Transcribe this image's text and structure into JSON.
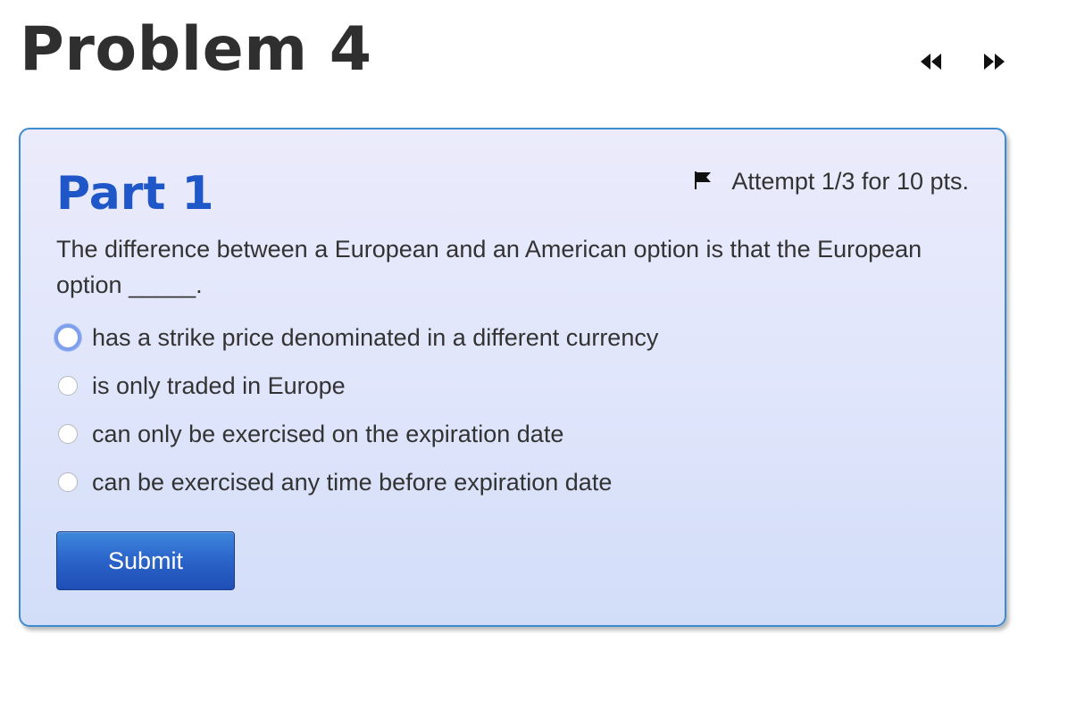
{
  "problem": {
    "title": "Problem 4"
  },
  "nav": {
    "prev_icon": "rewind-icon",
    "next_icon": "fast-forward-icon"
  },
  "part": {
    "title": "Part 1",
    "flag_icon": "flag-icon",
    "attempt_text": "Attempt 1/3 for 10 pts.",
    "question": "The difference between a European and an American option is that the European option _____.",
    "choices": [
      {
        "label": "has a strike price denominated in a different currency",
        "focused": true
      },
      {
        "label": "is only traded in Europe",
        "focused": false
      },
      {
        "label": "can only be exercised on the expiration date",
        "focused": false
      },
      {
        "label": "can be exercised any time before expiration date",
        "focused": false
      }
    ],
    "submit_label": "Submit"
  },
  "colors": {
    "title_text": "#2f2f2f",
    "part_title": "#1f57c8",
    "card_border": "#3f8bd0",
    "submit_bg": "#2a63c9",
    "radio_focus": "#7ea0ec"
  }
}
